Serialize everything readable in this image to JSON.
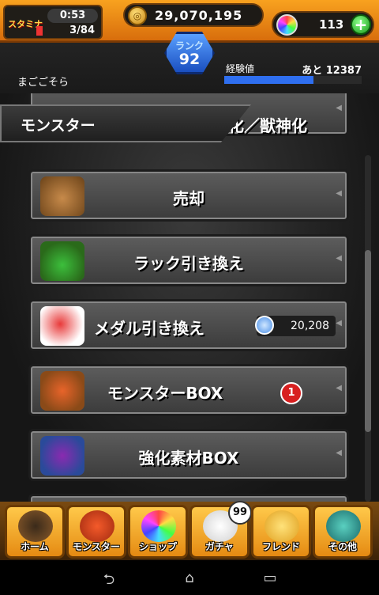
{
  "hud": {
    "stamina_label": "スタミナ",
    "stamina_timer": "0:53",
    "stamina_count": "3/84",
    "coins": "29,070,195",
    "orbs": "113",
    "orb_add": "+",
    "rank_label": "ランク",
    "rank_value": "92",
    "username": "まごごそら",
    "exp_label": "経験値",
    "exp_remaining": "あと 12387",
    "exp_progress": 0.65
  },
  "section": {
    "title": "モンスター",
    "partial_item_label": "進化／神化／獣神化"
  },
  "menu": {
    "items": [
      {
        "label": "売却"
      },
      {
        "label": "ラック引き換え"
      },
      {
        "label": "メダル引き換え",
        "medal_count": "20,208"
      },
      {
        "label": "モンスターBOX",
        "badge": "1"
      },
      {
        "label": "強化素材BOX"
      }
    ]
  },
  "tabbar": {
    "tabs": [
      {
        "label": "ホーム"
      },
      {
        "label": "モンスター"
      },
      {
        "label": "ショップ"
      },
      {
        "label": "ガチャ",
        "badge": "99"
      },
      {
        "label": "フレンド"
      },
      {
        "label": "その他"
      }
    ]
  },
  "navbar": {
    "back_icon": "back-icon",
    "home_icon": "home-icon",
    "recents_icon": "recents-icon"
  },
  "colors": {
    "accent": "#f39a1b",
    "exp_bar": "#2f6ff0",
    "badge": "#d82020"
  }
}
